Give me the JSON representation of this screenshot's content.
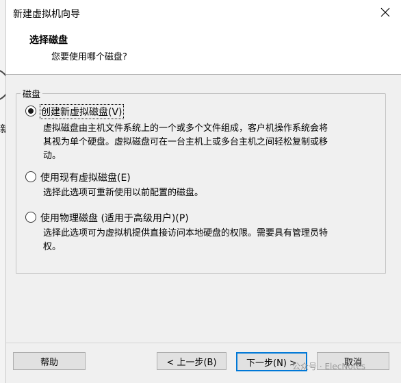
{
  "window": {
    "title": "新建虚拟机向导"
  },
  "header": {
    "title": "选择磁盘",
    "subtitle": "您要使用哪个磁盘?"
  },
  "group": {
    "label": "磁盘"
  },
  "options": [
    {
      "label": "创建新虚拟磁盘(V)",
      "selected": true,
      "desc_lines": [
        "虚拟磁盘由主机文件系统上的一个或多个文件组成，客户机操作系统会将",
        "其视为单个硬盘。虚拟磁盘可在一台主机上或多台主机之间轻松复制或移",
        "动。"
      ]
    },
    {
      "label": "使用现有虚拟磁盘(E)",
      "selected": false,
      "desc_lines": [
        "选择此选项可重新使用以前配置的磁盘。"
      ]
    },
    {
      "label": "使用物理磁盘 (适用于高级用户)(P)",
      "selected": false,
      "desc_lines": [
        "选择此选项可为虚拟机提供直接访问本地硬盘的权限。需要具有管理员特",
        "权。"
      ]
    }
  ],
  "buttons": {
    "help": "帮助",
    "back": "< 上一步(B)",
    "next": "下一步(N) >",
    "cancel": "取消"
  },
  "background": {
    "partial_char": "新"
  },
  "watermark": "公众号 · ElecNotes",
  "icons": {
    "close": "close-icon",
    "radio_selected": "radio-selected-icon",
    "radio_unselected": "radio-unselected-icon"
  }
}
